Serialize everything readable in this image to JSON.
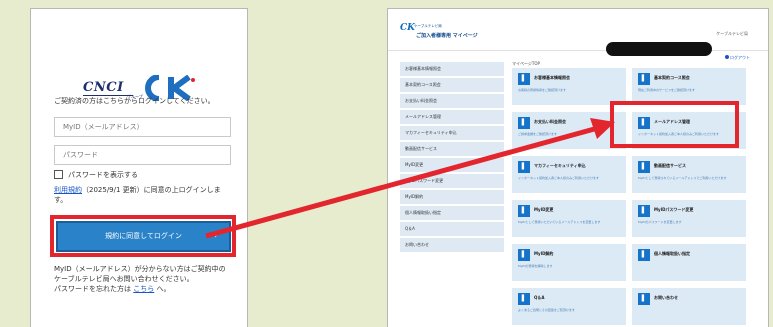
{
  "colors": {
    "background": "#e7eccf",
    "accent_red": "#e3262d",
    "button_blue": "#2a82c8",
    "card_blue": "#dceaf6",
    "sidebar_blue": "#dfe9f3"
  },
  "login": {
    "logo_text": "CNCI",
    "logo_group": "グループ",
    "logo_mark": "CK",
    "intro": "ご契約済の方はこちらからログインしてください。",
    "myid_placeholder": "MyID（メールアドレス）",
    "password_placeholder": "パスワード",
    "show_password_label": "パスワードを表示する",
    "terms_link": "利用規約",
    "terms_rest": "（2025/9/1 更新）に同意の上ログインします。",
    "login_button": "規約に同意してログイン",
    "login_button_arrow": "›",
    "help_text": "MyID（メールアドレス）が分からない方はご契約中のケーブルテレビ局へお問い合わせください。",
    "reset_prefix": "パスワードを忘れた方は",
    "reset_link": "こちら",
    "reset_suffix": "へ。"
  },
  "mypage": {
    "logo_mark": "CK",
    "logo_text": "ケーブルテレビ局",
    "title": "ご加入者様専用 マイページ",
    "company": "ケーブルテレビ局",
    "logout": "ログアウト",
    "breadcrumb": "マイページTOP",
    "sidebar": [
      "お客様基本情報照会",
      "基本契約コース照会",
      "お支払い料金照会",
      "メールアドレス管理",
      "マカフィーセキュリティ申込",
      "動画配信サービス",
      "MyID変更",
      "MyIDパスワード変更",
      "MyID解約",
      "個人情報取扱い指定",
      "Q＆A",
      "お問い合わせ"
    ],
    "cards": [
      {
        "title": "お客様基本情報照会",
        "desc": "お客様の登録情報をご確認頂けます"
      },
      {
        "title": "基本契約コース照会",
        "desc": "現在ご利用中のサービスをご確認頂けます"
      },
      {
        "title": "お支払い料金照会",
        "desc": "ご請求金額をご確認頂けます"
      },
      {
        "title": "メールアドレス管理",
        "desc": "インターネット契約加入者ご本人様のみご利用いただけます"
      },
      {
        "title": "マカフィーセキュリティ申込",
        "desc": "インターネット契約加入者ご本人様のみご利用いただけます"
      },
      {
        "title": "動画配信サービス",
        "desc": "MyIDとして登録されているメールアドレスでご利用いただけます"
      },
      {
        "title": "MyID変更",
        "desc": "MyIDとして登録いただいているメールアドレスを変更します"
      },
      {
        "title": "MyIDパスワード変更",
        "desc": "MyIDのパスワードを変更します"
      },
      {
        "title": "MyID解約",
        "desc": "MyIDの登録を解除します"
      },
      {
        "title": "個人情報取扱い指定",
        "desc": ""
      },
      {
        "title": "Q＆A",
        "desc": "よくあるご質問とその回答をご覧頂けます"
      },
      {
        "title": "お問い合わせ",
        "desc": ""
      }
    ]
  }
}
